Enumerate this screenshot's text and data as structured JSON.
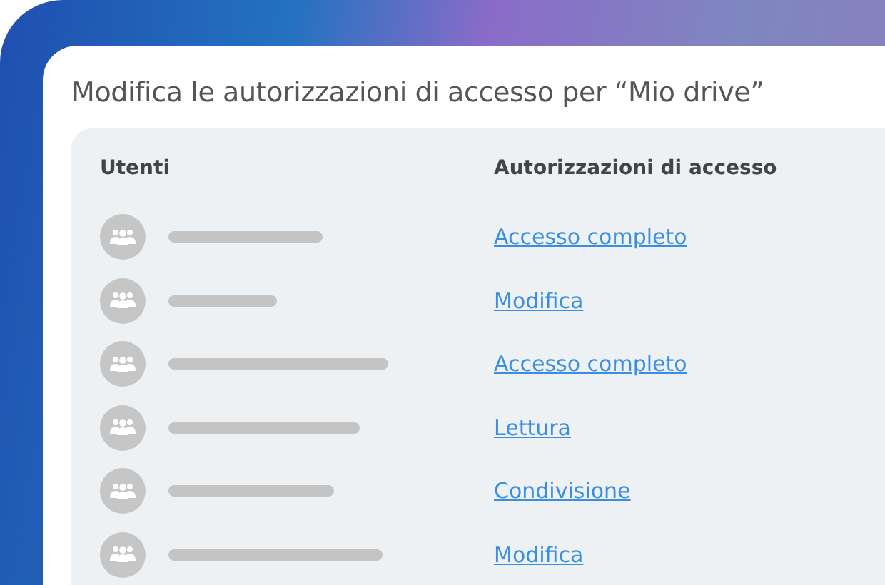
{
  "dialog": {
    "title": "Modifica le autorizzazioni di accesso per “Mio drive”"
  },
  "table": {
    "columns": [
      "Utenti",
      "Autorizzazioni di accesso"
    ],
    "rows": [
      {
        "permission": "Accesso completo"
      },
      {
        "permission": "Modifica"
      },
      {
        "permission": "Accesso completo"
      },
      {
        "permission": "Lettura"
      },
      {
        "permission": "Condivisione"
      },
      {
        "permission": "Modifica"
      }
    ]
  }
}
